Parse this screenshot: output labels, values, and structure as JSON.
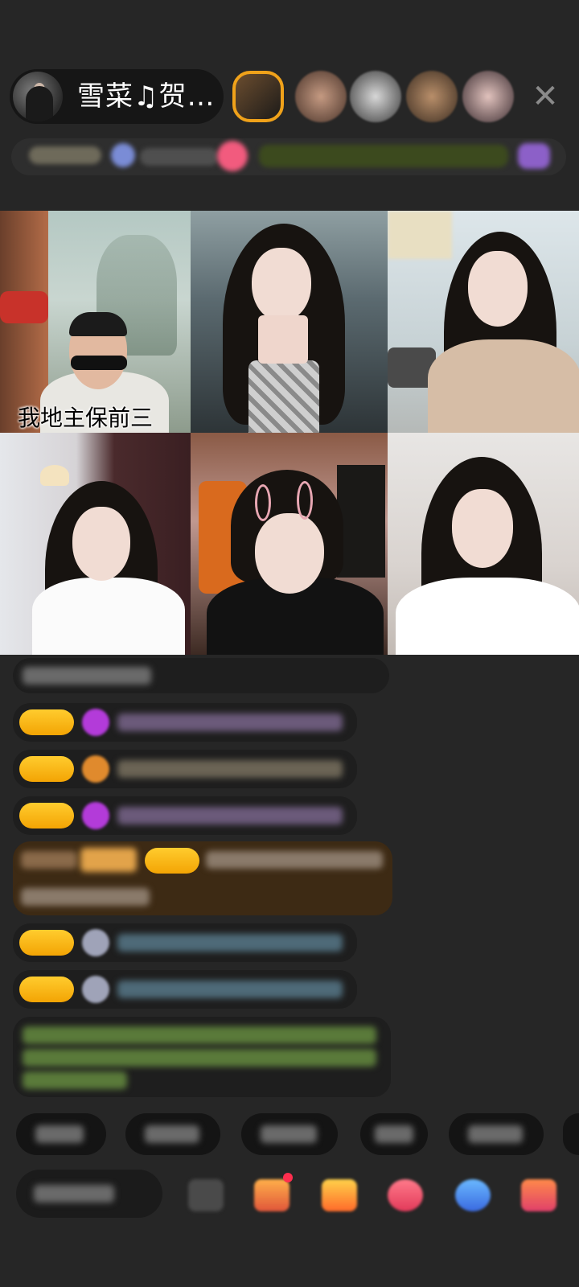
{
  "host": {
    "name": "雪菜♫贺…"
  },
  "grid": {
    "tile1_caption": "我地主保前三"
  },
  "icons": {
    "close": "close-icon",
    "viewer": "viewer-avatar-icon",
    "gift": "gift-icon",
    "more": "more-icon"
  },
  "colors": {
    "background": "#262626",
    "badge": "#f3a404",
    "viewer_highlight": "#f0a21a"
  }
}
